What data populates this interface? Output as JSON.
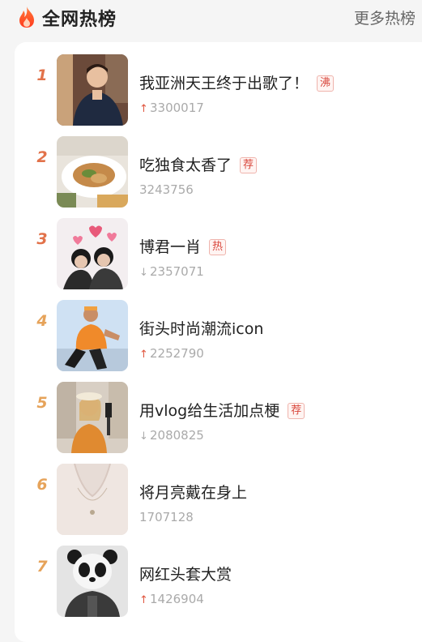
{
  "header": {
    "title": "全网热榜",
    "more_label": "更多热榜"
  },
  "list": [
    {
      "rank": "1",
      "topic": "我亚洲天王终于出歌了！",
      "badge": "沸",
      "trend": "up",
      "arrow": "↑",
      "value": "3300017"
    },
    {
      "rank": "2",
      "topic": "吃独食太香了",
      "badge": "荐",
      "trend": "none",
      "arrow": "",
      "value": "3243756"
    },
    {
      "rank": "3",
      "topic": "博君一肖",
      "badge": "热",
      "trend": "down",
      "arrow": "↓",
      "value": "2357071"
    },
    {
      "rank": "4",
      "topic": "街头时尚潮流icon",
      "badge": "",
      "trend": "up",
      "arrow": "↑",
      "value": "2252790"
    },
    {
      "rank": "5",
      "topic": "用vlog给生活加点梗",
      "badge": "荐",
      "trend": "down",
      "arrow": "↓",
      "value": "2080825"
    },
    {
      "rank": "6",
      "topic": "将月亮戴在身上",
      "badge": "",
      "trend": "none",
      "arrow": "",
      "value": "1707128"
    },
    {
      "rank": "7",
      "topic": "网红头套大赏",
      "badge": "",
      "trend": "up",
      "arrow": "↑",
      "value": "1426904"
    }
  ],
  "colors": {
    "accent": "#ff5a2a",
    "rank_top": "#e2724a",
    "rank_other": "#e6a35a",
    "badge": "#d8463b",
    "up_arrow": "#e0563f"
  }
}
